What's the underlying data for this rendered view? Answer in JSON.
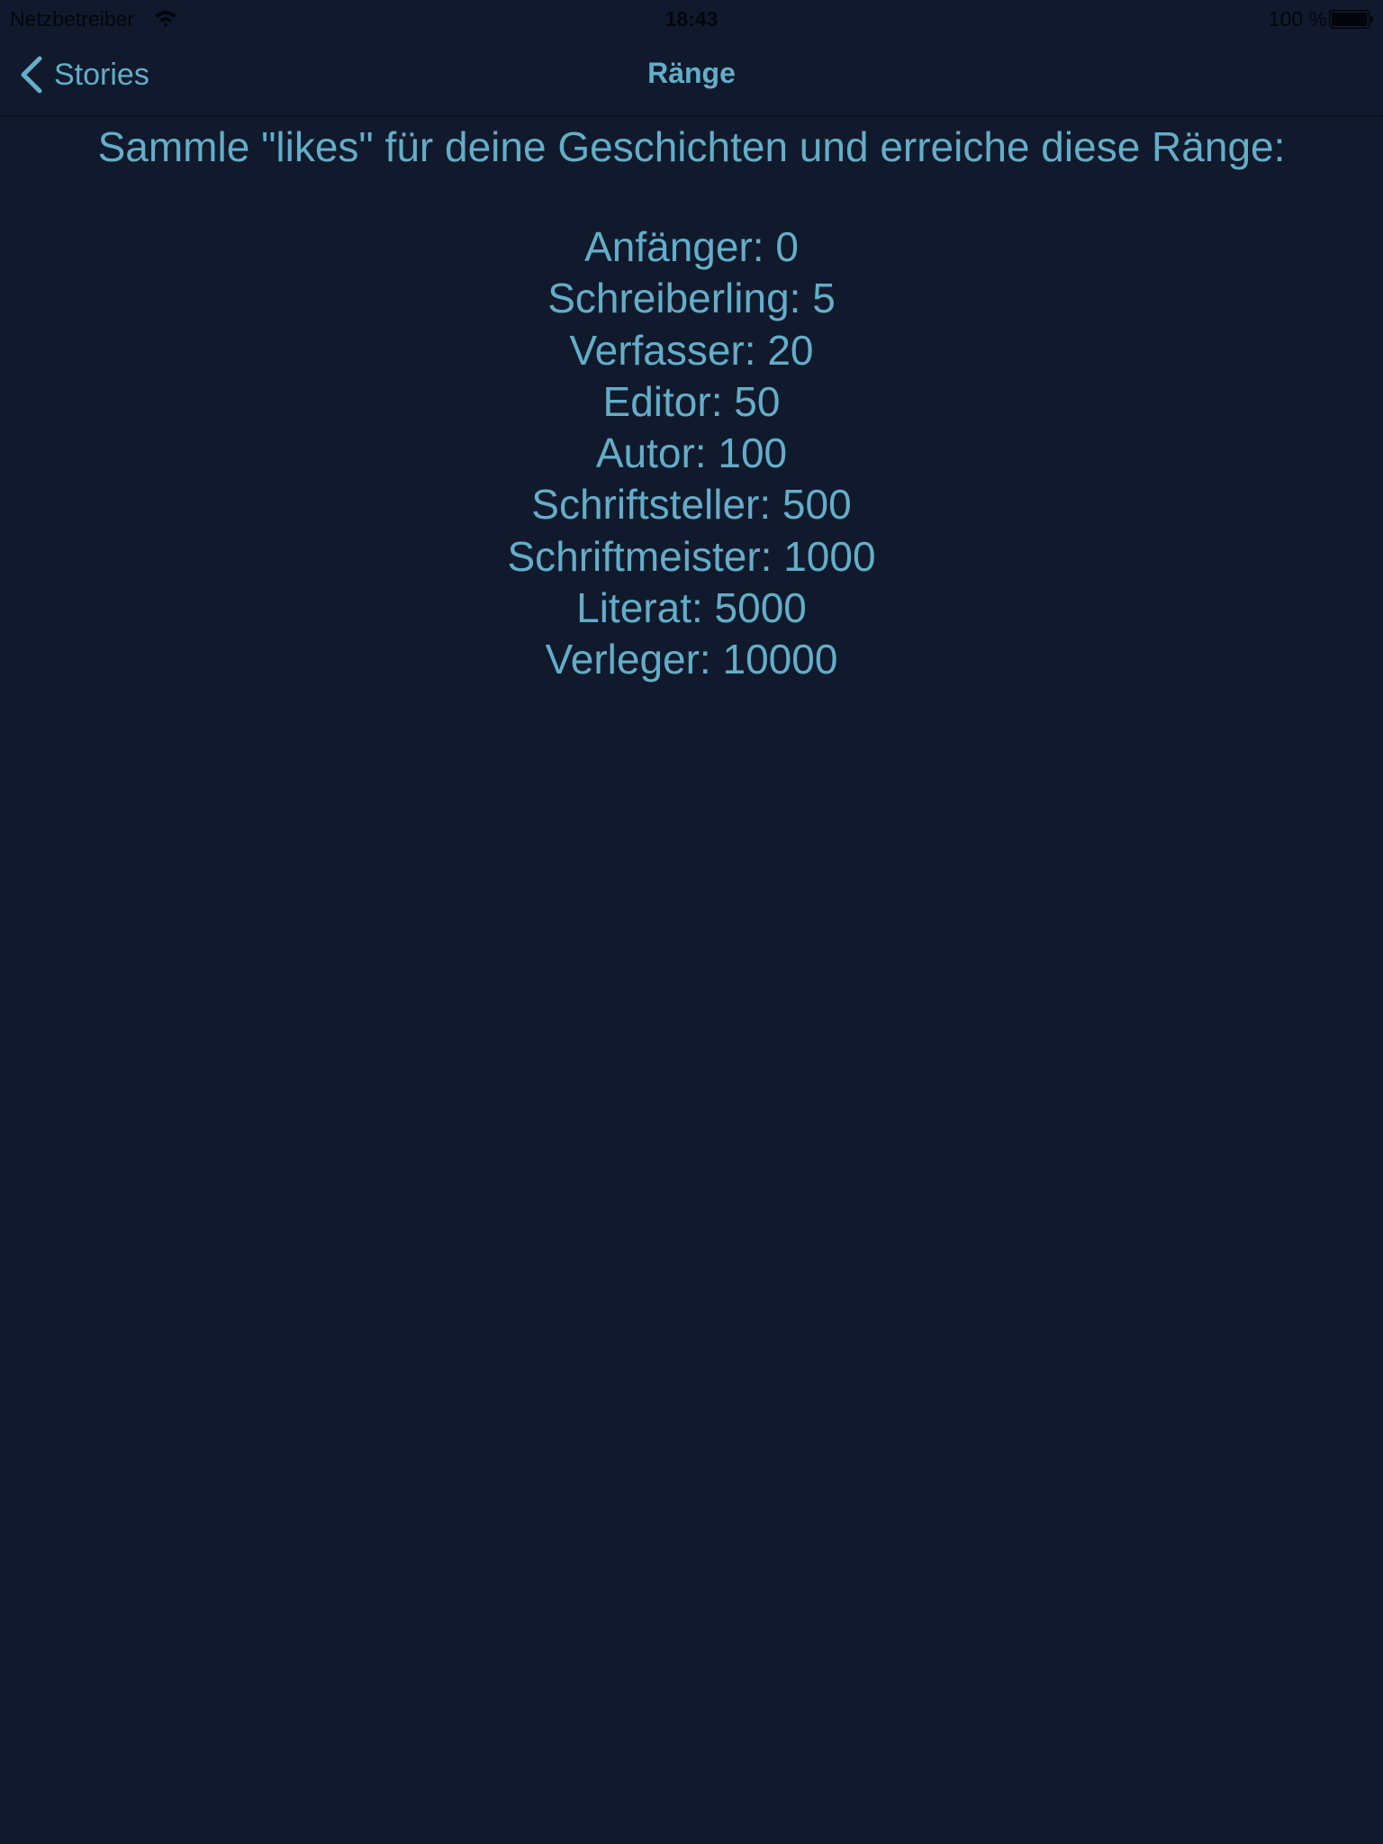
{
  "status_bar": {
    "carrier": "Netzbetreiber",
    "time": "18:43",
    "battery": "100 %",
    "wifi_icon": "wifi-icon",
    "battery_icon": "battery-full-icon"
  },
  "nav": {
    "back_label": "Stories",
    "back_icon": "chevron-left-icon",
    "title": "Ränge"
  },
  "content": {
    "intro": "Sammle \"likes\" für deine Geschichten und erreiche diese Ränge:",
    "ranks": [
      "Anfänger: 0",
      "Schreiberling: 5",
      "Verfasser: 20",
      "Editor: 50",
      "Autor: 100",
      "Schriftsteller: 500",
      "Schriftmeister: 1000",
      "Literat: 5000",
      "Verleger: 10000"
    ]
  },
  "colors": {
    "background": "#111a2c",
    "accent": "#64adc8",
    "status_text": "#02060c"
  }
}
